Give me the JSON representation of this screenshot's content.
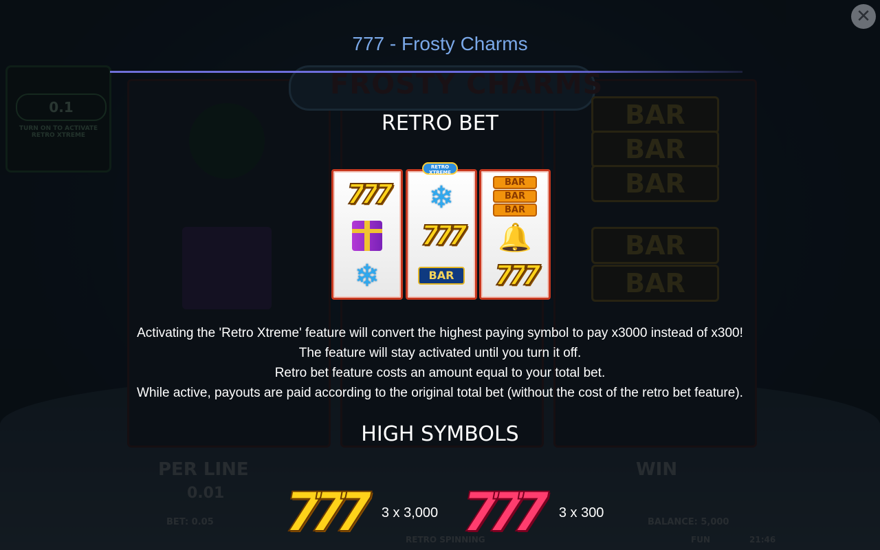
{
  "overlay": {
    "title": "777 - Frosty Charms",
    "close_label": "✕"
  },
  "background_game": {
    "logo": "FROSTY CHARMS",
    "retro_panel": {
      "value": "0.1",
      "note": "TURN ON TO ACTIVATE RETRO XTREME"
    },
    "per_line_label": "PER LINE",
    "per_line_value": "0.01",
    "win_label": "WIN",
    "bet_label": "BET: 0.05",
    "balance_label": "BALANCE: 5,000",
    "fun_label": "FUN",
    "time": "21:46",
    "retro_spinning": "RETRO SPINNING",
    "reel_bar_symbol": "BAR"
  },
  "retro_bet": {
    "heading": "RETRO BET",
    "badge": "RETRO XTREME",
    "reels": [
      [
        "seven-icon",
        "gift-icon",
        "snowflake-icon"
      ],
      [
        "snowflake-icon",
        "seven-icon",
        "bar-icon"
      ],
      [
        "triple-bar-icon",
        "bell-icon",
        "seven-icon"
      ]
    ],
    "bar_text": "BAR",
    "description": [
      "Activating the 'Retro Xtreme' feature will convert the highest paying symbol to pay x3000 instead of x300!",
      "The feature will stay activated until you turn it off.",
      "Retro bet feature costs an amount equal to your total bet.",
      "While active, payouts are paid according to the original total bet (without the cost of the retro bet feature)."
    ]
  },
  "high_symbols": {
    "heading": "HIGH SYMBOLS",
    "items": [
      {
        "symbol": "777",
        "color": "gold",
        "payout": "3 x 3,000"
      },
      {
        "symbol": "777",
        "color": "red",
        "payout": "3 x 300"
      }
    ]
  },
  "colors": {
    "title": "#7aa8e8",
    "rule": "#6a6adf",
    "reel_frame": "#c7381f",
    "gold_seven": "#ffd21a",
    "red_seven": "#ff3d6e"
  }
}
